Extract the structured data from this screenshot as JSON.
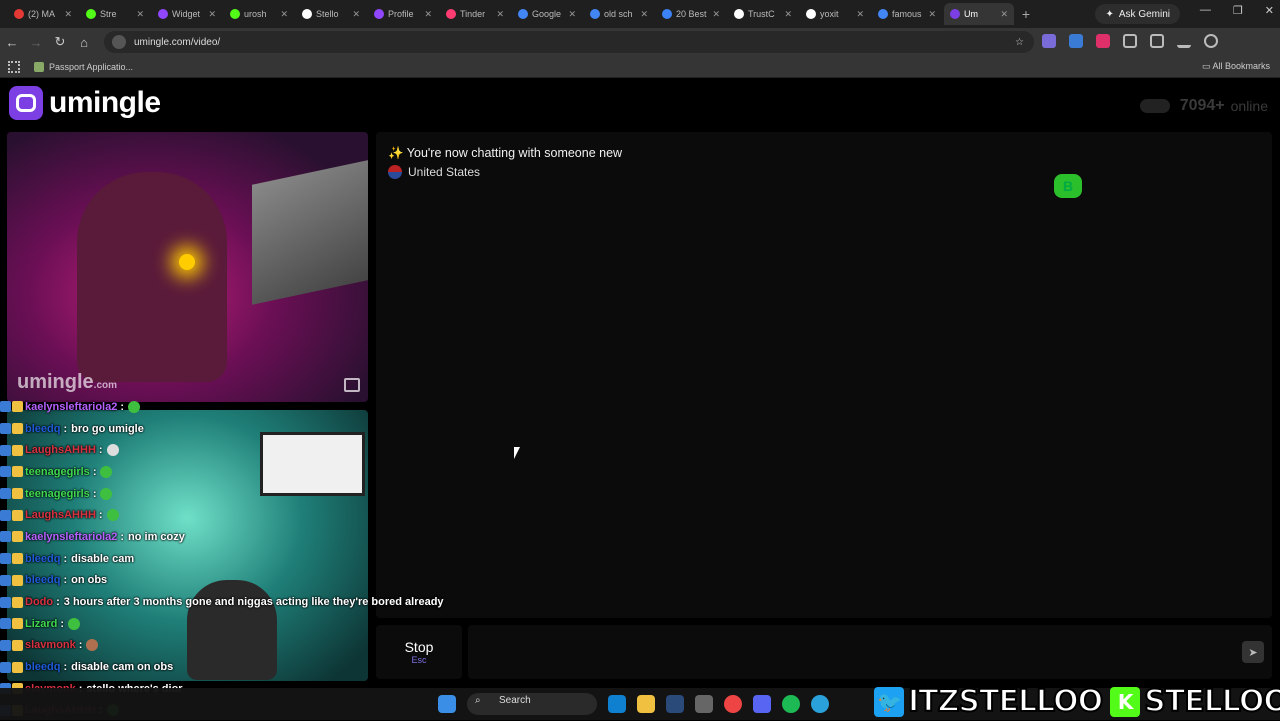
{
  "browser": {
    "tabs": [
      {
        "label": "(2) MA",
        "color": "#e53935"
      },
      {
        "label": "Stre",
        "color": "#53fc18"
      },
      {
        "label": "Widget",
        "color": "#9146ff"
      },
      {
        "label": "urosh",
        "color": "#53fc18"
      },
      {
        "label": "Stello",
        "color": "#ffffff"
      },
      {
        "label": "Profile",
        "color": "#9146ff"
      },
      {
        "label": "Tinder",
        "color": "#fe3c72"
      },
      {
        "label": "Google",
        "color": "#4285f4"
      },
      {
        "label": "old sch",
        "color": "#4285f4"
      },
      {
        "label": "20 Best",
        "color": "#3b82f6"
      },
      {
        "label": "TrustC",
        "color": "#ffffff"
      },
      {
        "label": "yoxit",
        "color": "#ffffff"
      },
      {
        "label": "famous",
        "color": "#4285f4"
      },
      {
        "label": "Um",
        "color": "#7b3fe4"
      }
    ],
    "gemini_label": "Ask Gemini",
    "url": "umingle.com/video/",
    "bookmark": "Passport Applicatio...",
    "all_bookmarks": "All Bookmarks"
  },
  "site": {
    "logo_text": "umingle",
    "online_count": "7094+",
    "online_label": "online",
    "watermark": "umingle",
    "watermark_suffix": ".com",
    "chat_status": "✨ You're now chatting with someone new",
    "country": "United States",
    "stop_label": "Stop",
    "stop_key": "Esc",
    "send_icon": "send-icon"
  },
  "stream_chat": [
    {
      "user": "kaelynsleftariola2",
      "color": "#b660ff",
      "msg": "",
      "emote": "#3fbf3f"
    },
    {
      "user": "bleedq",
      "color": "#1e5bd8",
      "msg": "bro go umigle",
      "emote": ""
    },
    {
      "user": "LaughsAHHH",
      "color": "#d83040",
      "msg": "",
      "emote": "#dddddd"
    },
    {
      "user": "teenagegirls",
      "color": "#3fd84f",
      "msg": "",
      "emote": "#3fbf3f"
    },
    {
      "user": "teenagegirls",
      "color": "#3fd84f",
      "msg": "",
      "emote": "#3fbf3f"
    },
    {
      "user": "LaughsAHHH",
      "color": "#d83040",
      "msg": "",
      "emote": "#3fbf3f"
    },
    {
      "user": "kaelynsleftariola2",
      "color": "#b660ff",
      "msg": "no im cozy",
      "emote": ""
    },
    {
      "user": "bleedq",
      "color": "#1e5bd8",
      "msg": "disable cam",
      "emote": ""
    },
    {
      "user": "bleedq",
      "color": "#1e5bd8",
      "msg": "on obs",
      "emote": ""
    },
    {
      "user": "Dodo",
      "color": "#d83040",
      "msg": "3 hours after 3 months gone and niggas acting like they're bored already",
      "emote": ""
    },
    {
      "user": "Lizard",
      "color": "#3fd84f",
      "msg": "",
      "emote": "#3fbf3f"
    },
    {
      "user": "slavmonk",
      "color": "#d83040",
      "msg": "",
      "emote": "#b07050"
    },
    {
      "user": "bleedq",
      "color": "#1e5bd8",
      "msg": "disable cam on obs",
      "emote": ""
    },
    {
      "user": "slavmonk",
      "color": "#d83040",
      "msg": "stello where's dior",
      "emote": ""
    },
    {
      "user": "LaughsAHHH",
      "color": "#d83040",
      "msg": "",
      "emote": "#3fbf3f"
    }
  ],
  "taskbar": {
    "search_label": "Search"
  },
  "socials": [
    {
      "handle": "ITZSTELLOO",
      "icon": "twitter-icon",
      "color": "#1da1f2"
    },
    {
      "handle": "STELLOOO",
      "icon": "kick-icon",
      "color": "#53fc18"
    }
  ]
}
